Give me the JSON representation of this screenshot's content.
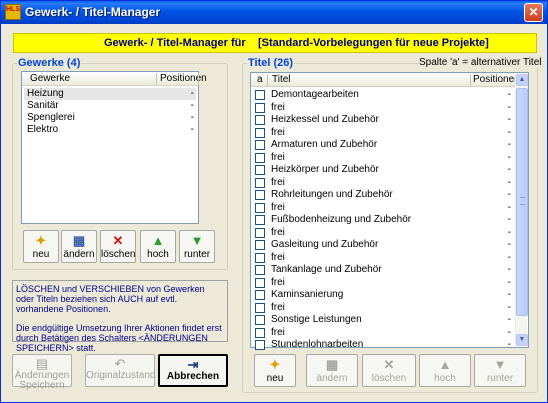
{
  "window": {
    "app_icon_text": "HLS",
    "title": "Gewerk- / Titel-Manager",
    "close_glyph": "✕"
  },
  "banner": {
    "left": "Gewerk- / Titel-Manager für",
    "right": "[Standard-Vorbelegungen für neue Projekte]"
  },
  "gewerke": {
    "label": "Gewerke (4)",
    "columns": {
      "name": "Gewerke",
      "positions": "Positionen"
    },
    "rows": [
      {
        "name": "Heizung",
        "positions": "-"
      },
      {
        "name": "Sanitär",
        "positions": "-"
      },
      {
        "name": "Spenglerei",
        "positions": "-"
      },
      {
        "name": "Elektro",
        "positions": "-"
      }
    ],
    "toolbar": {
      "neu": "neu",
      "aendern": "ändern",
      "loeschen": "löschen",
      "hoch": "hoch",
      "runter": "runter"
    }
  },
  "info": {
    "p1": "LÖSCHEN und VERSCHIEBEN von Gewerken oder Titeln beziehen sich AUCH auf evtl. vorhandene Positionen.",
    "p2": "Die endgültige Umsetzung Ihrer Aktionen findet erst durch Betätigen des Schalters <ÄNDERUNGEN SPEICHERN> statt."
  },
  "bottom_buttons": {
    "save": "Änderungen Speichern",
    "revert": "Originalzustand",
    "cancel": "Abbrechen"
  },
  "titel": {
    "label": "Titel (26)",
    "hint": "Spalte 'a' = alternativer Titel",
    "columns": {
      "a": "a",
      "title": "Titel",
      "positions": "Positionen"
    },
    "rows": [
      {
        "title": "Demontagearbeiten",
        "positions": "-"
      },
      {
        "title": "frei",
        "positions": "-"
      },
      {
        "title": "Heizkessel und Zubehör",
        "positions": "-"
      },
      {
        "title": "frei",
        "positions": "-"
      },
      {
        "title": "Armaturen und Zubehör",
        "positions": "-"
      },
      {
        "title": "frei",
        "positions": "-"
      },
      {
        "title": "Heizkörper und Zubehör",
        "positions": "-"
      },
      {
        "title": "frei",
        "positions": "-"
      },
      {
        "title": "Rohrleitungen und Zubehör",
        "positions": "-"
      },
      {
        "title": "frei",
        "positions": "-"
      },
      {
        "title": "Fußbodenheizung und Zubehör",
        "positions": "-"
      },
      {
        "title": "frei",
        "positions": "-"
      },
      {
        "title": "Gasleitung und Zubehör",
        "positions": "-"
      },
      {
        "title": "frei",
        "positions": "-"
      },
      {
        "title": "Tankanlage und Zubehör",
        "positions": "-"
      },
      {
        "title": "frei",
        "positions": "-"
      },
      {
        "title": "Kaminsanierung",
        "positions": "-"
      },
      {
        "title": "frei",
        "positions": "-"
      },
      {
        "title": "Sonstige Leistungen",
        "positions": "-"
      },
      {
        "title": "frei",
        "positions": "-"
      },
      {
        "title": "Stundenlohnarbeiten",
        "positions": "-"
      }
    ],
    "toolbar": {
      "neu": "neu",
      "aendern": "ändern",
      "loeschen": "löschen",
      "hoch": "hoch",
      "runter": "runter"
    }
  },
  "icons": {
    "new": "new-document-icon",
    "edit": "edit-icon",
    "delete": "delete-icon",
    "up": "arrow-up-icon",
    "down": "arrow-down-icon",
    "save": "save-icon",
    "undo": "undo-icon",
    "exit": "exit-door-icon"
  },
  "colors": {
    "title_bar": "#0054e3",
    "banner_bg": "#ffff00",
    "banner_text": "#00008b",
    "group_label": "#0046d5",
    "info_text": "#00008b"
  }
}
